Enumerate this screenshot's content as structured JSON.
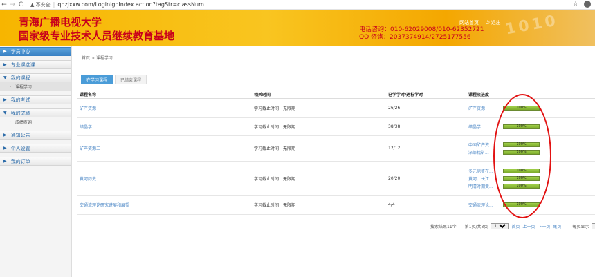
{
  "browser": {
    "back": "←",
    "forward": "→",
    "reload": "C",
    "security": "▲ 不安全",
    "url": "qhzjxxw.com/LoginIgoIndex.action?tagStr=classNum",
    "star": "☆"
  },
  "banner": {
    "title1": "青海广播电视大学",
    "title2": "国家级专业技术人员继续教育基地",
    "phone": "电话咨询：010-62029008/010-62352721",
    "qq": "QQ 咨询：2037374914/2725177556",
    "link_home": "网站首页",
    "link_logout": "退出",
    "deco": "1010"
  },
  "sidebar": {
    "items": [
      {
        "label": "学员中心"
      },
      {
        "label": "专业课选课"
      },
      {
        "label": "我的课程"
      },
      {
        "label": "课程学习"
      },
      {
        "label": "我的考试"
      },
      {
        "label": "我的成绩"
      },
      {
        "label": "成绩查询"
      },
      {
        "label": "通知公告"
      },
      {
        "label": "个人设置"
      },
      {
        "label": "我的订单"
      }
    ]
  },
  "main": {
    "breadcrumb": "首页 > 课程学习",
    "tabs": [
      {
        "label": "在学习课程"
      },
      {
        "label": "已结束课程"
      }
    ],
    "headers": {
      "name": "课程名称",
      "time": "相关时间",
      "hours": "已学学时/达标学时",
      "progress": "课程及进度"
    },
    "rows": [
      {
        "name": "矿产资源",
        "time": "学习截止时间：无限期",
        "hours": "26/26",
        "progress": [
          {
            "label": "矿产资源",
            "pct": "100%"
          }
        ]
      },
      {
        "name": "结晶学",
        "time": "学习截止时间：无限期",
        "hours": "38/38",
        "progress": [
          {
            "label": "结晶学",
            "pct": "100%"
          }
        ]
      },
      {
        "name": "矿产资源二",
        "time": "学习截止时间：无限期",
        "hours": "12/12",
        "progress": [
          {
            "label": "中国矿产资...",
            "pct": "100%"
          },
          {
            "label": "深部找矿...",
            "pct": "100%"
          }
        ]
      },
      {
        "name": "黄河历史",
        "time": "学习截止时间：无限期",
        "hours": "20/20",
        "progress": [
          {
            "label": "多元鼎盛在...",
            "pct": "100%"
          },
          {
            "label": "黄河、长江...",
            "pct": "100%"
          },
          {
            "label": "明清时期黄...",
            "pct": "100%"
          }
        ]
      },
      {
        "name": "交通流理论研究进展和展望",
        "time": "学习截止时间：无限期",
        "hours": "4/4",
        "progress": [
          {
            "label": "交通流理论...",
            "pct": "100%"
          }
        ]
      }
    ],
    "pager": {
      "total": "搜索结果11个",
      "page": "第1页/共3页",
      "page_select": "1",
      "first": "首页",
      "prev": "上一页",
      "next": "下一页",
      "last": "尾页",
      "per_page_label": "每页显示",
      "per_page_select": "5"
    }
  }
}
